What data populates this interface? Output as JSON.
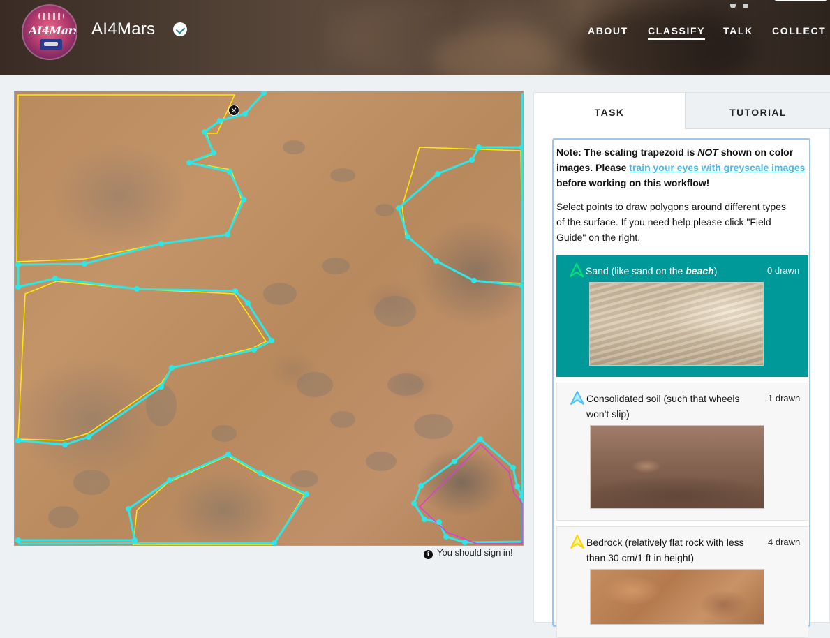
{
  "header": {
    "project_title": "AI4Mars",
    "logo_text": "AI4Mars",
    "nav": [
      "ABOUT",
      "CLASSIFY",
      "TALK",
      "COLLECT"
    ],
    "active_nav": "CLASSIFY"
  },
  "subject": {
    "sign_in_message": "You should sign in!"
  },
  "tabs": [
    "TASK",
    "TUTORIAL"
  ],
  "task": {
    "note_prefix": "Note: The scaling trapezoid is ",
    "note_emphasis": "NOT",
    "note_mid": " shown on color images. Please ",
    "note_link": "train your eyes with greyscale images",
    "note_suffix": " before working on this workflow!",
    "instructions": "Select points to draw polygons around different types of the surface. If you need help please click \"Field Guide\" on the right.",
    "answers": [
      {
        "label_prefix": "Sand (like sand on the ",
        "label_emphasis": "beach",
        "label_suffix": ")",
        "count": "0 drawn",
        "color": "#00c853",
        "selected": true
      },
      {
        "label": "Consolidated soil (such that wheels won't slip)",
        "count": "1 drawn",
        "color": "#4fc3f7",
        "selected": false
      },
      {
        "label": "Bedrock (relatively flat rock with less than 30 cm/1 ft in height)",
        "count": "4 drawn",
        "color": "#ffd400",
        "selected": false
      }
    ]
  },
  "colors": {
    "teal_selected": "#009999",
    "annotation_cyan": "#2ee6e6",
    "annotation_yellow": "#ffea00",
    "annotation_magenta": "#e03ad8",
    "link": "#4fb7e6"
  }
}
